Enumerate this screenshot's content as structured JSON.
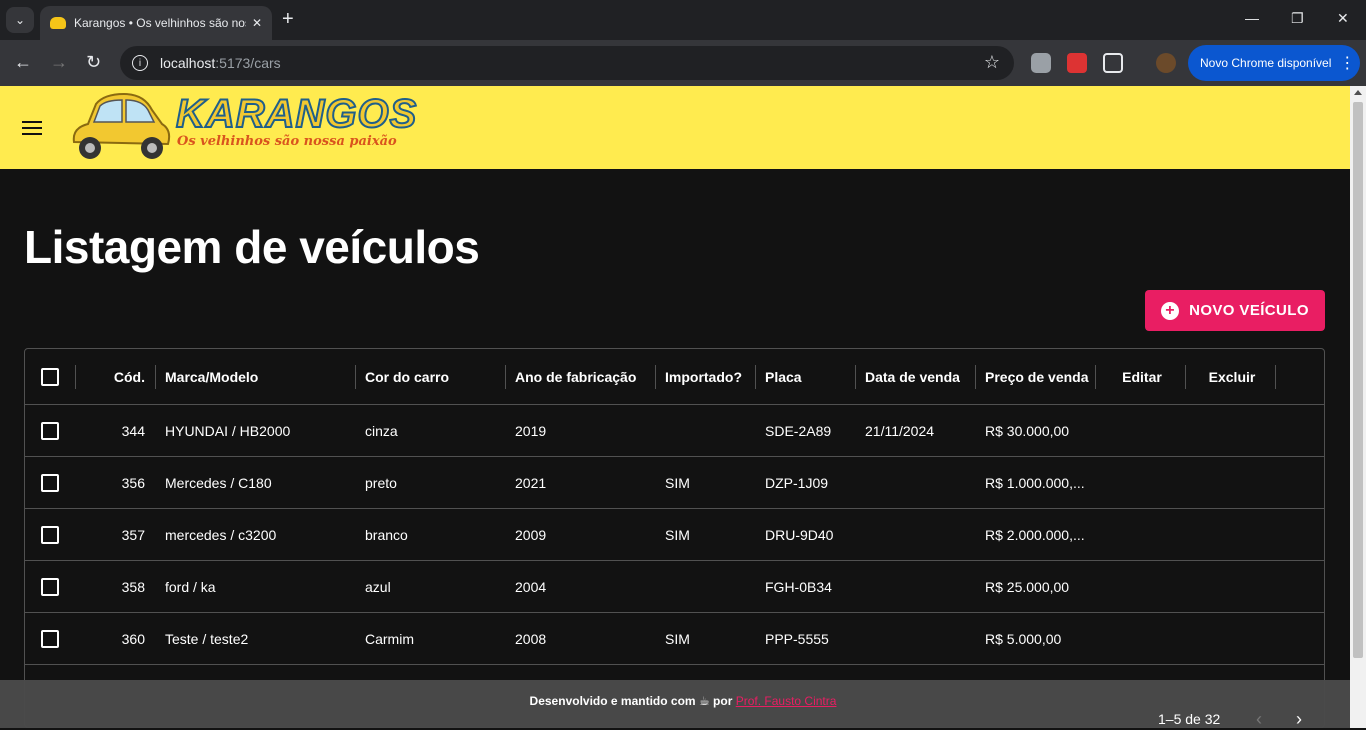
{
  "browser": {
    "tab_title": "Karangos • Os velhinhos são nossa paixão",
    "url_host": "localhost",
    "url_path": ":5173/cars",
    "update_label": "Novo Chrome disponível"
  },
  "header": {
    "logo_title": "KARANGOS",
    "logo_subtitle": "Os velhinhos são nossa paixão"
  },
  "page": {
    "title": "Listagem de veículos",
    "new_button": "NOVO VEÍCULO"
  },
  "grid": {
    "columns": [
      "Cód.",
      "Marca/Modelo",
      "Cor do carro",
      "Ano de fabricação",
      "Importado?",
      "Placa",
      "Data de venda",
      "Preço de venda",
      "Editar",
      "Excluir"
    ],
    "rows": [
      {
        "id": "344",
        "model": "HYUNDAI / HB2000",
        "color": "cinza",
        "year": "2019",
        "imported": "",
        "plate": "SDE-2A89",
        "sale_date": "21/11/2024",
        "price": "R$ 30.000,00"
      },
      {
        "id": "356",
        "model": "Mercedes / C180",
        "color": "preto",
        "year": "2021",
        "imported": "SIM",
        "plate": "DZP-1J09",
        "sale_date": "",
        "price": "R$ 1.000.000,..."
      },
      {
        "id": "357",
        "model": "mercedes / c3200",
        "color": "branco",
        "year": "2009",
        "imported": "SIM",
        "plate": "DRU-9D40",
        "sale_date": "",
        "price": "R$ 2.000.000,..."
      },
      {
        "id": "358",
        "model": "ford / ka",
        "color": "azul",
        "year": "2004",
        "imported": "",
        "plate": "FGH-0B34",
        "sale_date": "",
        "price": "R$ 25.000,00"
      },
      {
        "id": "360",
        "model": "Teste / teste2",
        "color": "Carmim",
        "year": "2008",
        "imported": "SIM",
        "plate": "PPP-5555",
        "sale_date": "",
        "price": "R$ 5.000,00"
      }
    ],
    "pagination": "1–5 de 32"
  },
  "footer": {
    "text_before": "Desenvolvido e mantido com",
    "text_mid": "por",
    "author": "Prof. Fausto Cintra"
  },
  "colors": {
    "header_bg": "#ffeb4f",
    "accent": "#e91e63",
    "background": "#121212"
  }
}
